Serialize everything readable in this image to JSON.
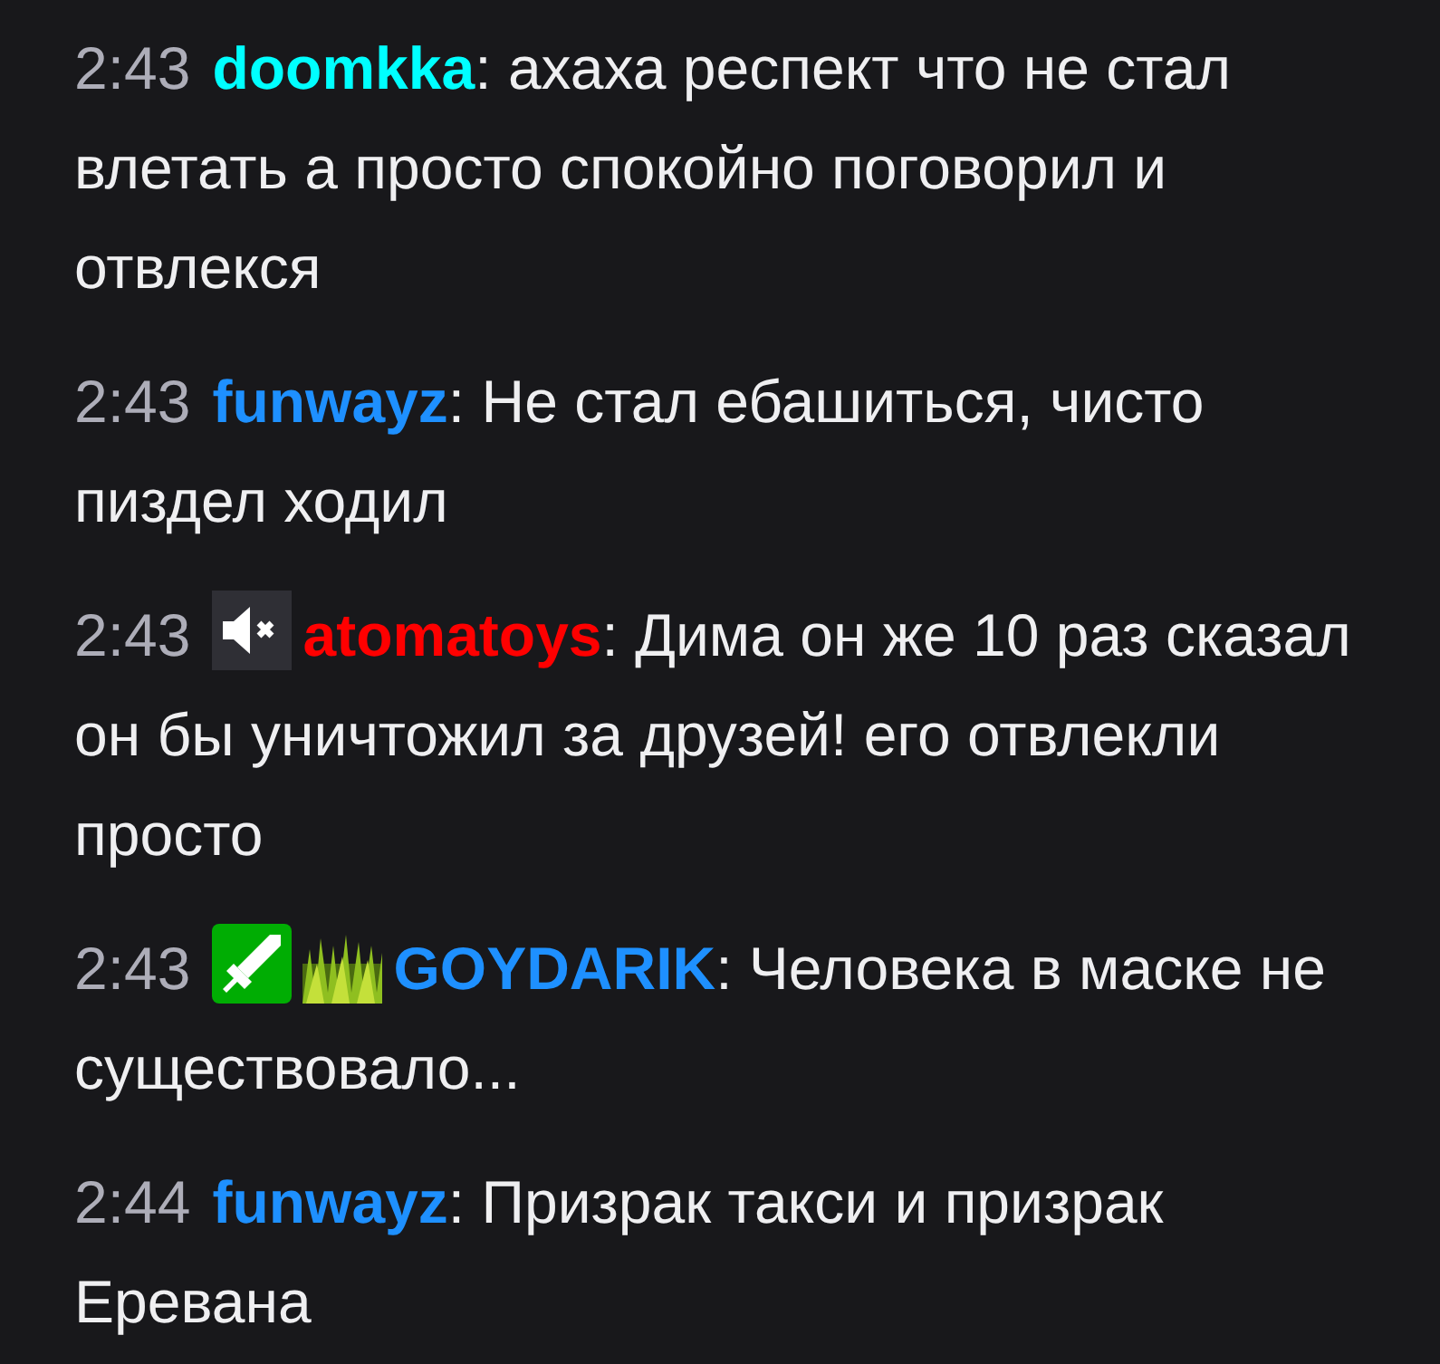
{
  "messages": [
    {
      "time": "2:43",
      "username": "doomkka",
      "color": "#00ffff",
      "separator": ":",
      "text": "ахаха респект что не стал влетать а просто спокойно поговорил и отвлекся"
    },
    {
      "time": "2:43",
      "username": "funwayz",
      "color": "#1e90ff",
      "separator": ":",
      "text": "Не стал ебашиться, чисто пиздел ходил"
    },
    {
      "time": "2:43",
      "badges": [
        {
          "kind": "muted"
        }
      ],
      "username": "atomatoys",
      "color": "#ff0000",
      "separator": ":",
      "text": "Дима он же 10 раз сказал он бы уничтожил за друзей! его отвлекли просто"
    },
    {
      "time": "2:43",
      "badges": [
        {
          "kind": "moderator"
        },
        {
          "kind": "grass"
        }
      ],
      "username": "GOYDARIK",
      "color": "#1e90ff",
      "separator": ":",
      "text": "Человека в маске не существовало..."
    },
    {
      "time": "2:44",
      "username": "funwayz",
      "color": "#1e90ff",
      "separator": ":",
      "text": "Призрак такси и призрак Еревана"
    }
  ]
}
